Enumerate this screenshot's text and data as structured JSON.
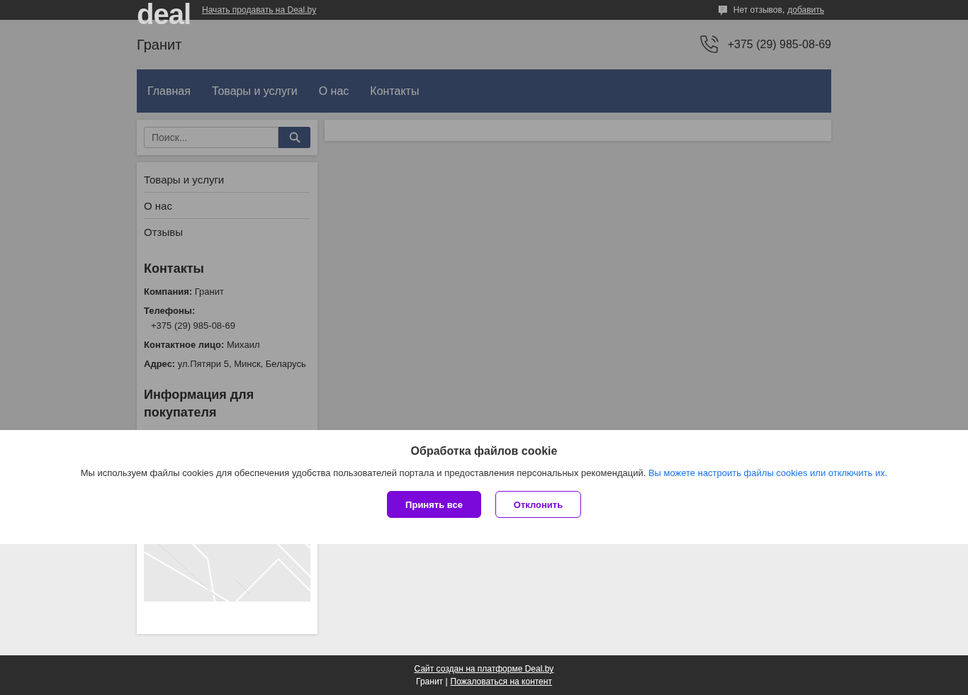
{
  "topbar": {
    "logo": "deal",
    "sell_link": "Начать продавать на Deal.by",
    "reviews_text": "Нет отзывов,",
    "reviews_link": "добавить"
  },
  "header": {
    "title": "Гранит",
    "phone": "+375 (29) 985-08-69"
  },
  "nav": [
    {
      "label": "Главная"
    },
    {
      "label": "Товары и услуги"
    },
    {
      "label": "О нас"
    },
    {
      "label": "Контакты"
    }
  ],
  "search": {
    "placeholder": "Поиск..."
  },
  "sidebar_menu": [
    "Товары и услуги",
    "О нас",
    "Отзывы"
  ],
  "contacts": {
    "heading": "Контакты",
    "fields": [
      {
        "label": "Компания:",
        "value": "Гранит",
        "kind": "inline"
      },
      {
        "label": "Телефоны:",
        "value": "+375 (29) 985-08-69",
        "kind": "block"
      },
      {
        "label": "Контактное лицо:",
        "value": "Михаил",
        "kind": "inline"
      },
      {
        "label": "Адрес:",
        "value": "ул.Пятяри 5, Минск, Беларусь",
        "kind": "inline"
      }
    ]
  },
  "info_heading": "Информация для покупателя",
  "cookie": {
    "title": "Обработка файлов cookie",
    "text": "Мы используем файлы cookies для обеспечения удобства пользователей портала и предоставления персональных рекомендаций.",
    "link": "Вы можете настроить файлы cookies или отключить их.",
    "accept": "Принять все",
    "decline": "Отклонить"
  },
  "footer": {
    "platform_link": "Сайт создан на платформе Deal.by",
    "company": "Гранит |",
    "report_link": "Пожаловаться на контент"
  }
}
